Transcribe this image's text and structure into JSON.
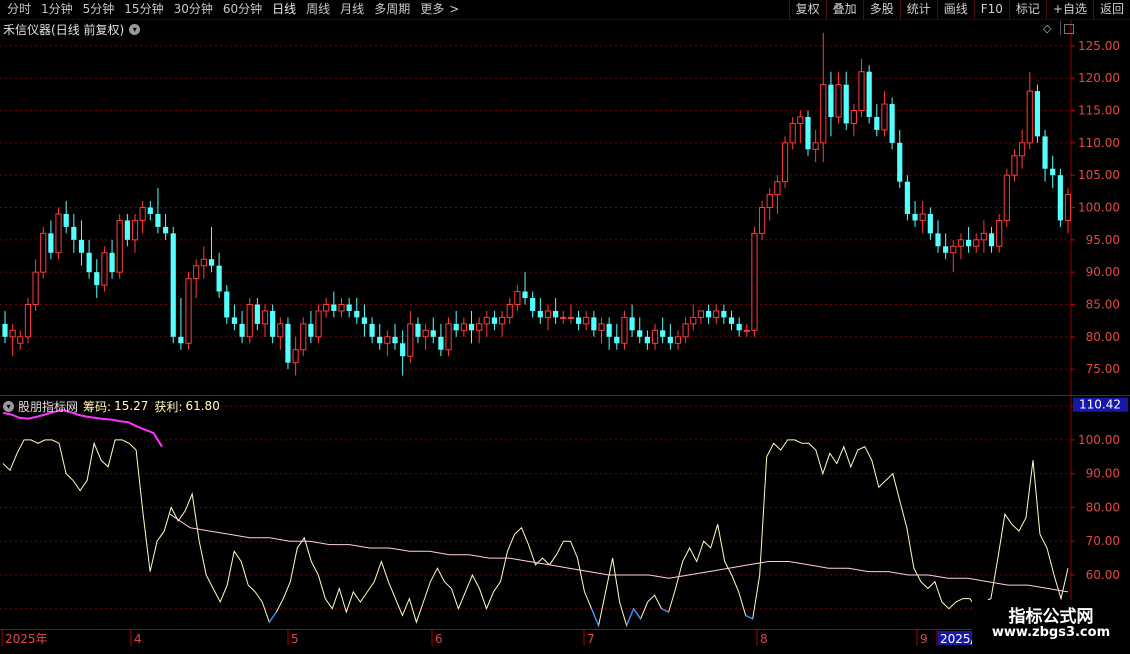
{
  "toolbar": {
    "periods": [
      "分时",
      "1分钟",
      "5分钟",
      "15分钟",
      "30分钟",
      "60分钟",
      "日线",
      "周线",
      "月线",
      "多周期",
      "更多"
    ],
    "active_period": "日线",
    "more_arrow": ">",
    "right_buttons": [
      "复权",
      "叠加",
      "多股",
      "统计",
      "画线",
      "F10",
      "标记",
      "+自选",
      "返回"
    ]
  },
  "colors": {
    "up": "#ff3b3b",
    "down": "#54ffff",
    "grid": "#7a0000",
    "axis_text": "#e04848",
    "ma_line": "#ffd0e0",
    "indicator_line": "#ffffc0",
    "magenta": "#ff33ff",
    "blue": "#3a8fff",
    "highlight_label": "#1818a8"
  },
  "chart_title": {
    "stock": "禾信仪器",
    "mode": "(日线 前复权)"
  },
  "indicator_title": {
    "name": "股朋指标网",
    "chip_label": "筹码:",
    "chip_value": "15.27",
    "profit_label": "获利:",
    "profit_value": "61.80"
  },
  "current_value_label": "110.42",
  "watermark": {
    "title": "指标公式网",
    "url": "www.zbgs3.com"
  },
  "date_axis": [
    "2025年",
    "4",
    "5",
    "6",
    "7",
    "8",
    "9",
    "2025/"
  ],
  "chart_data": [
    {
      "type": "candlestick",
      "ylim": [
        71,
        129
      ],
      "y_ticks": [
        75.0,
        80.0,
        85.0,
        90.0,
        95.0,
        100.0,
        105.0,
        110.0,
        115.0,
        120.0,
        125.0
      ],
      "ohlc": [
        [
          82,
          84,
          79,
          80
        ],
        [
          80,
          82,
          77,
          81
        ],
        [
          79,
          81,
          78,
          80
        ],
        [
          80,
          86,
          79,
          85
        ],
        [
          85,
          92,
          84,
          90
        ],
        [
          90,
          97,
          89,
          96
        ],
        [
          96,
          98,
          92,
          93
        ],
        [
          93,
          100,
          92,
          99
        ],
        [
          99,
          101,
          96,
          97
        ],
        [
          97,
          99,
          93,
          95
        ],
        [
          95,
          98,
          91,
          93
        ],
        [
          93,
          95,
          89,
          90
        ],
        [
          90,
          92,
          86,
          88
        ],
        [
          88,
          94,
          87,
          93
        ],
        [
          93,
          95,
          89,
          90
        ],
        [
          90,
          99,
          89,
          98
        ],
        [
          98,
          99,
          94,
          95
        ],
        [
          95,
          99,
          93,
          98
        ],
        [
          98,
          101,
          96,
          100
        ],
        [
          100,
          101,
          98,
          99
        ],
        [
          99,
          103,
          96,
          97
        ],
        [
          97,
          99,
          95,
          96
        ],
        [
          96,
          97,
          79,
          80
        ],
        [
          80,
          86,
          78,
          79
        ],
        [
          79,
          90,
          78,
          89
        ],
        [
          89,
          92,
          86,
          91
        ],
        [
          91,
          94,
          89,
          92
        ],
        [
          92,
          97,
          90,
          91
        ],
        [
          91,
          93,
          86,
          87
        ],
        [
          87,
          88,
          82,
          83
        ],
        [
          83,
          85,
          81,
          82
        ],
        [
          82,
          84,
          79,
          80
        ],
        [
          80,
          86,
          79,
          85
        ],
        [
          85,
          86,
          81,
          82
        ],
        [
          82,
          85,
          80,
          84
        ],
        [
          84,
          85,
          79,
          80
        ],
        [
          80,
          83,
          78,
          82
        ],
        [
          82,
          83,
          75,
          76
        ],
        [
          76,
          80,
          74,
          78
        ],
        [
          78,
          83,
          77,
          82
        ],
        [
          82,
          84,
          79,
          80
        ],
        [
          80,
          85,
          79,
          84
        ],
        [
          84,
          86,
          83,
          85
        ],
        [
          85,
          87,
          83,
          84
        ],
        [
          84,
          86,
          83,
          85
        ],
        [
          85,
          86,
          83,
          84
        ],
        [
          84,
          86,
          82,
          83
        ],
        [
          83,
          85,
          80,
          82
        ],
        [
          82,
          83,
          79,
          80
        ],
        [
          80,
          82,
          78,
          79
        ],
        [
          79,
          81,
          77,
          80
        ],
        [
          80,
          82,
          78,
          79
        ],
        [
          79,
          81,
          74,
          77
        ],
        [
          77,
          84,
          76,
          82
        ],
        [
          82,
          83,
          79,
          80
        ],
        [
          80,
          82,
          78,
          81
        ],
        [
          81,
          83,
          79,
          80
        ],
        [
          80,
          82,
          77,
          78
        ],
        [
          78,
          83,
          77,
          82
        ],
        [
          82,
          84,
          80,
          81
        ],
        [
          81,
          83,
          80,
          82
        ],
        [
          82,
          84,
          79,
          81
        ],
        [
          81,
          83,
          79,
          82
        ],
        [
          82,
          84,
          80,
          83
        ],
        [
          83,
          84,
          81,
          82
        ],
        [
          82,
          84,
          80,
          83
        ],
        [
          83,
          86,
          82,
          85
        ],
        [
          85,
          88,
          84,
          87
        ],
        [
          87,
          90,
          85,
          86
        ],
        [
          86,
          87,
          83,
          84
        ],
        [
          84,
          86,
          82,
          83
        ],
        [
          83,
          85,
          81,
          84
        ],
        [
          84,
          86,
          82,
          83
        ],
        [
          83,
          84,
          82,
          83
        ],
        [
          83,
          85,
          82,
          83
        ],
        [
          83,
          84,
          81,
          82
        ],
        [
          82,
          84,
          81,
          83
        ],
        [
          83,
          84,
          80,
          81
        ],
        [
          81,
          83,
          79,
          82
        ],
        [
          82,
          83,
          78,
          80
        ],
        [
          80,
          82,
          78,
          79
        ],
        [
          79,
          84,
          78,
          83
        ],
        [
          83,
          85,
          80,
          81
        ],
        [
          81,
          83,
          79,
          80
        ],
        [
          80,
          81,
          78,
          79
        ],
        [
          79,
          82,
          78,
          81
        ],
        [
          81,
          83,
          79,
          80
        ],
        [
          80,
          82,
          78,
          79
        ],
        [
          79,
          81,
          78,
          80
        ],
        [
          80,
          83,
          79,
          82
        ],
        [
          82,
          85,
          81,
          83
        ],
        [
          83,
          84,
          82,
          84
        ],
        [
          84,
          85,
          82,
          83
        ],
        [
          83,
          85,
          82,
          84
        ],
        [
          84,
          85,
          82,
          83
        ],
        [
          83,
          84,
          81,
          82
        ],
        [
          82,
          83,
          80,
          81
        ],
        [
          81,
          82,
          80,
          81
        ],
        [
          81,
          97,
          80,
          96
        ],
        [
          96,
          101,
          95,
          100
        ],
        [
          100,
          103,
          98,
          102
        ],
        [
          102,
          105,
          99,
          104
        ],
        [
          104,
          111,
          103,
          110
        ],
        [
          110,
          114,
          109,
          113
        ],
        [
          113,
          115,
          110,
          114
        ],
        [
          114,
          115,
          108,
          109
        ],
        [
          109,
          112,
          107,
          110
        ],
        [
          110,
          127,
          107,
          119
        ],
        [
          119,
          121,
          111,
          114
        ],
        [
          114,
          121,
          113,
          119
        ],
        [
          119,
          121,
          112,
          113
        ],
        [
          113,
          116,
          111,
          115
        ],
        [
          115,
          123,
          114,
          121
        ],
        [
          121,
          122,
          113,
          114
        ],
        [
          114,
          116,
          111,
          112
        ],
        [
          112,
          118,
          111,
          116
        ],
        [
          116,
          117,
          109,
          110
        ],
        [
          110,
          112,
          103,
          104
        ],
        [
          104,
          105,
          98,
          99
        ],
        [
          99,
          101,
          97,
          98
        ],
        [
          98,
          101,
          96,
          99
        ],
        [
          99,
          100,
          95,
          96
        ],
        [
          96,
          98,
          93,
          94
        ],
        [
          94,
          96,
          92,
          93
        ],
        [
          93,
          95,
          90,
          94
        ],
        [
          94,
          96,
          92,
          95
        ],
        [
          95,
          97,
          93,
          94
        ],
        [
          94,
          96,
          93,
          95
        ],
        [
          95,
          98,
          93,
          96
        ],
        [
          96,
          97,
          93,
          94
        ],
        [
          94,
          99,
          93,
          98
        ],
        [
          98,
          106,
          97,
          105
        ],
        [
          105,
          109,
          104,
          108
        ],
        [
          108,
          112,
          106,
          110
        ],
        [
          110,
          121,
          109,
          118
        ],
        [
          118,
          119,
          110,
          111
        ],
        [
          111,
          112,
          104,
          106
        ],
        [
          106,
          108,
          103,
          105
        ],
        [
          105,
          106,
          97,
          98
        ],
        [
          98,
          103,
          96,
          102
        ]
      ]
    },
    {
      "type": "line",
      "ylim": [
        44,
        113
      ],
      "y_ticks": [
        50.0,
        60.0,
        70.0,
        80.0,
        90.0,
        100.0,
        110.0
      ],
      "series": [
        {
          "values": [
            93,
            91,
            96,
            100,
            100,
            99,
            100,
            100,
            99,
            90,
            88,
            85,
            88,
            99,
            94,
            92,
            100,
            100,
            99,
            97,
            78,
            61,
            70,
            73,
            80,
            76,
            79,
            84,
            70,
            60,
            56,
            52,
            57,
            67,
            64,
            57,
            55,
            52,
            46,
            49,
            53,
            58,
            68,
            71,
            64,
            60,
            53,
            50,
            56,
            49,
            55,
            52,
            55,
            58,
            64,
            58,
            53,
            48,
            53,
            46,
            52,
            58,
            62,
            58,
            56,
            50,
            55,
            60,
            56,
            50,
            55,
            58,
            67,
            72,
            74,
            69,
            63,
            65,
            63,
            66,
            70,
            70,
            65,
            55,
            50,
            45,
            55,
            65,
            52,
            45,
            50,
            47,
            52,
            54,
            50,
            49,
            56,
            64,
            68,
            64,
            70,
            68,
            75,
            64,
            60,
            55,
            48,
            47,
            60,
            95,
            99,
            97,
            100,
            100,
            99,
            99,
            97,
            90,
            96,
            93,
            98,
            92,
            97,
            98,
            94,
            86,
            88,
            90,
            82,
            74,
            62,
            58,
            56,
            58,
            52,
            50,
            52,
            53,
            53,
            50,
            52,
            53,
            65,
            78,
            75,
            73,
            77,
            94,
            72,
            68,
            60,
            53,
            62
          ]
        },
        {
          "values": [
            78,
            74,
            73,
            72,
            71,
            71,
            70,
            70,
            69,
            69,
            68,
            68,
            67,
            67,
            66,
            66,
            65,
            65,
            64,
            63,
            62,
            61,
            60,
            60,
            60,
            59,
            60,
            61,
            62,
            63,
            64,
            64,
            63,
            62,
            62,
            61,
            61,
            60,
            60,
            59,
            59,
            58,
            57,
            57,
            56,
            55
          ]
        }
      ]
    }
  ]
}
